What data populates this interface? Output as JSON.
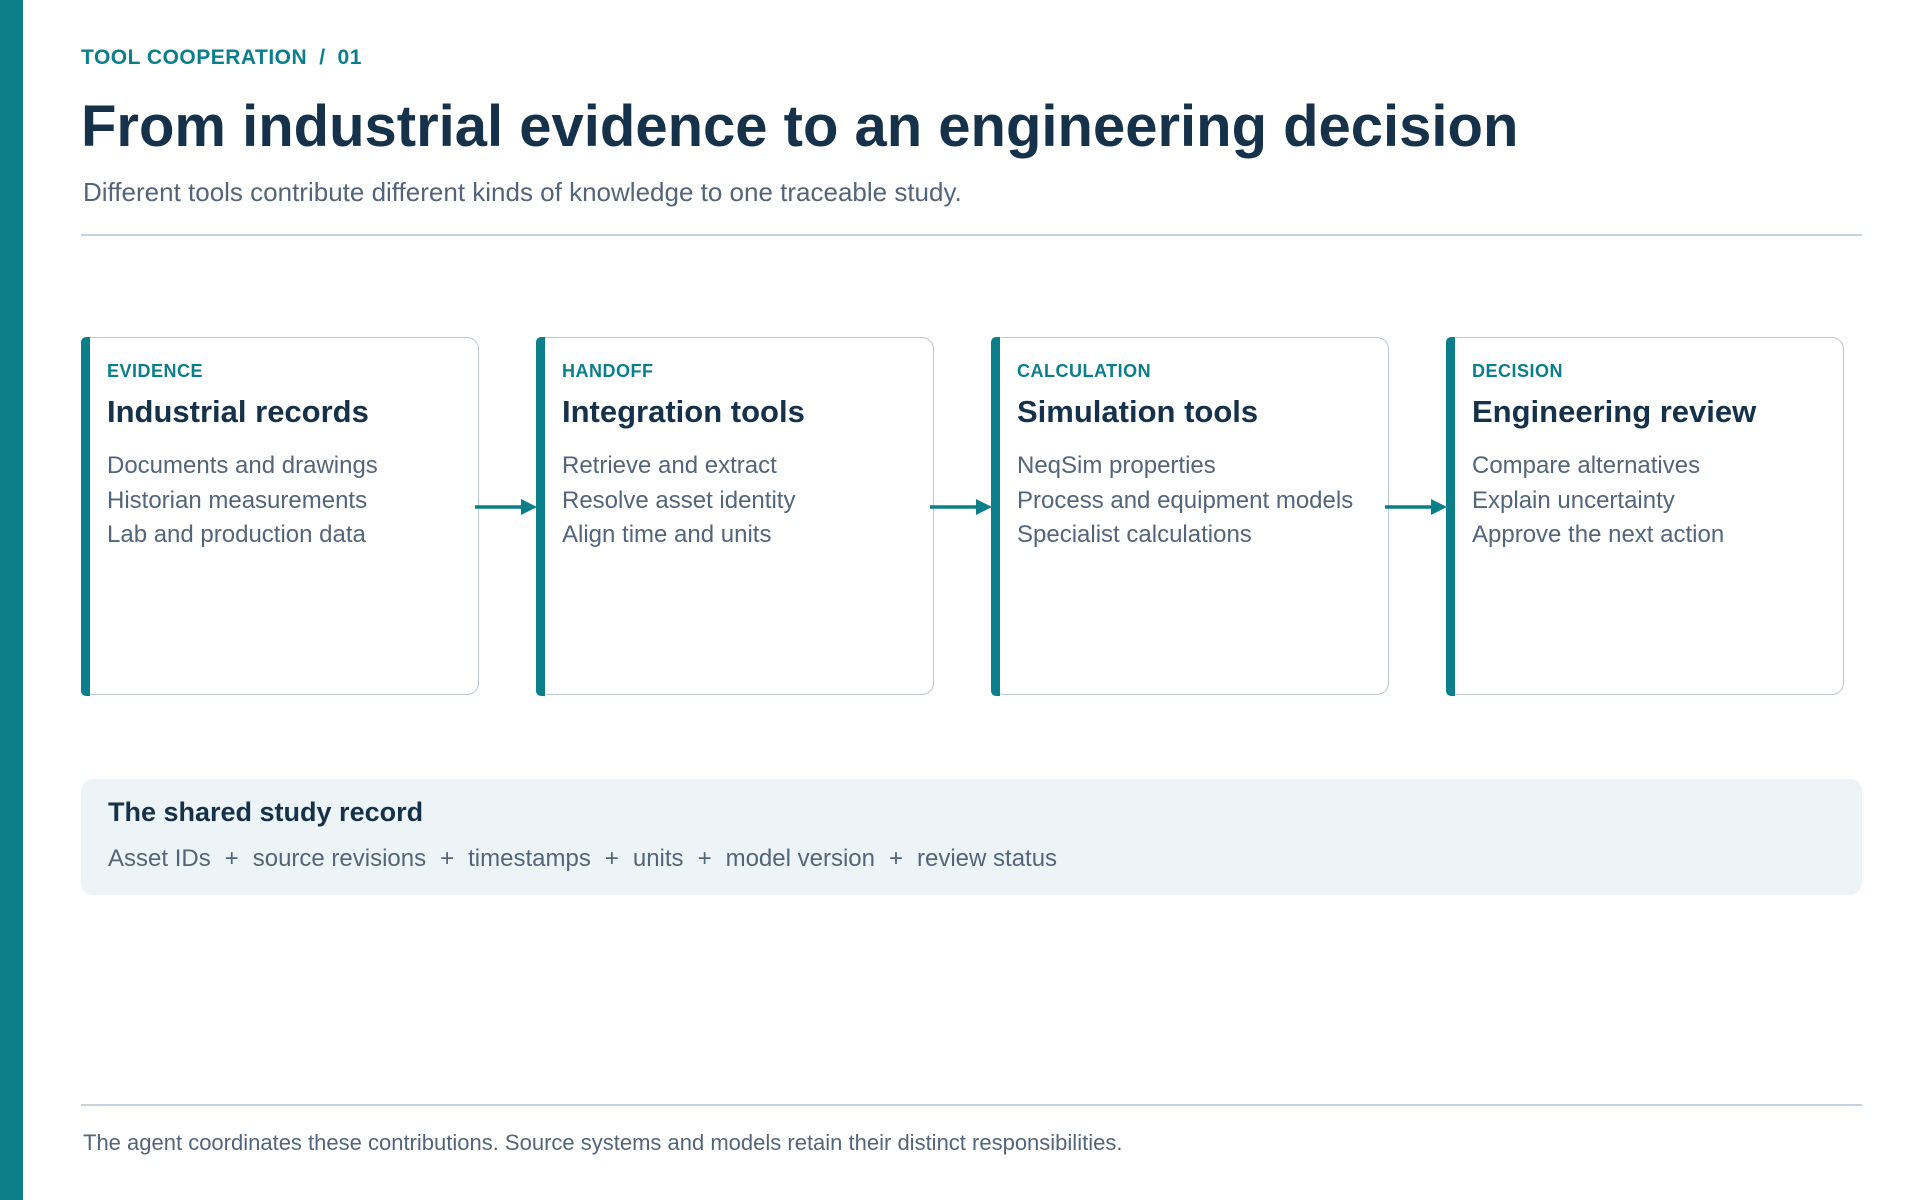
{
  "header": {
    "eyebrow_section": "TOOL COOPERATION",
    "eyebrow_separator": "/",
    "eyebrow_number": "01",
    "title": "From industrial evidence to an engineering decision",
    "subtitle": "Different tools contribute different kinds of knowledge to one traceable study."
  },
  "flow": {
    "stages": [
      {
        "label": "EVIDENCE",
        "title": "Industrial records",
        "items": [
          "Documents and drawings",
          "Historian measurements",
          "Lab and production data"
        ]
      },
      {
        "label": "HANDOFF",
        "title": "Integration tools",
        "items": [
          "Retrieve and extract",
          "Resolve asset identity",
          "Align time and units"
        ]
      },
      {
        "label": "CALCULATION",
        "title": "Simulation tools",
        "items": [
          "NeqSim properties",
          "Process and equipment models",
          "Specialist calculations"
        ]
      },
      {
        "label": "DECISION",
        "title": "Engineering review",
        "items": [
          "Compare alternatives",
          "Explain uncertainty",
          "Approve the next action"
        ]
      }
    ]
  },
  "shared_record": {
    "title": "The shared study record",
    "items": [
      "Asset IDs",
      "source revisions",
      "timestamps",
      "units",
      "model version",
      "review status"
    ],
    "separator": "+"
  },
  "footer": {
    "text": "The agent coordinates these contributions. Source systems and models retain their distinct responsibilities."
  },
  "colors": {
    "accent": "#0a7f8a",
    "heading": "#15324a",
    "body_text": "#52657a",
    "card_border": "#b9c8d5",
    "panel_background": "#edf4f7"
  }
}
